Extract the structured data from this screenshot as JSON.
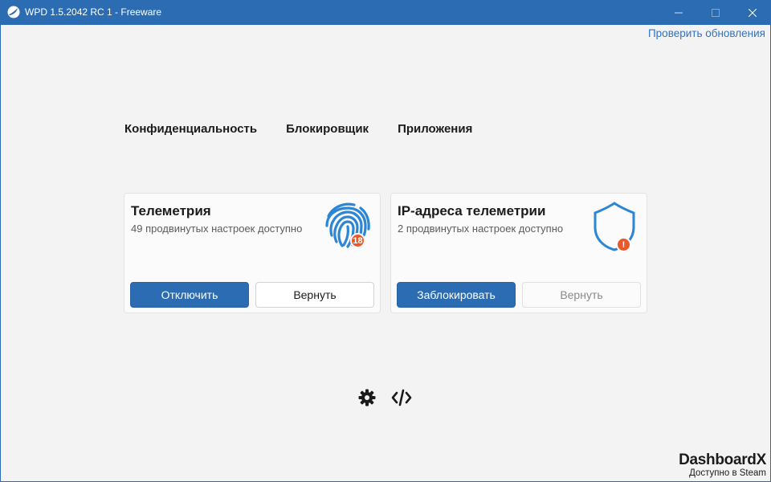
{
  "window": {
    "title": "WPD 1.5.2042 RC 1 - Freeware",
    "controls": [
      "minimize-icon",
      "maximize-icon",
      "close-icon"
    ]
  },
  "header": {
    "update_link": "Проверить обновления"
  },
  "tabs": [
    {
      "label": "Конфиденциальность"
    },
    {
      "label": "Блокировщик"
    },
    {
      "label": "Приложения"
    }
  ],
  "cards": [
    {
      "title": "Телеметрия",
      "subtitle": "49 продвинутых настроек доступно",
      "icon": "fingerprint-icon",
      "badge": "18",
      "primary_label": "Отключить",
      "secondary_label": "Вернуть",
      "secondary_enabled": true
    },
    {
      "title": "IP-адреса телеметрии",
      "subtitle": "2 продвинутых настроек доступно",
      "icon": "shield-icon",
      "badge": "!",
      "primary_label": "Заблокировать",
      "secondary_label": "Вернуть",
      "secondary_enabled": false
    }
  ],
  "footer": {
    "icons": [
      "gear-icon",
      "code-icon"
    ],
    "brand_logo": "DashboardX",
    "brand_sub": "Доступно в Steam"
  },
  "colors": {
    "accent": "#2b6cb3",
    "badge": "#e8582a",
    "link": "#2b73c8"
  }
}
